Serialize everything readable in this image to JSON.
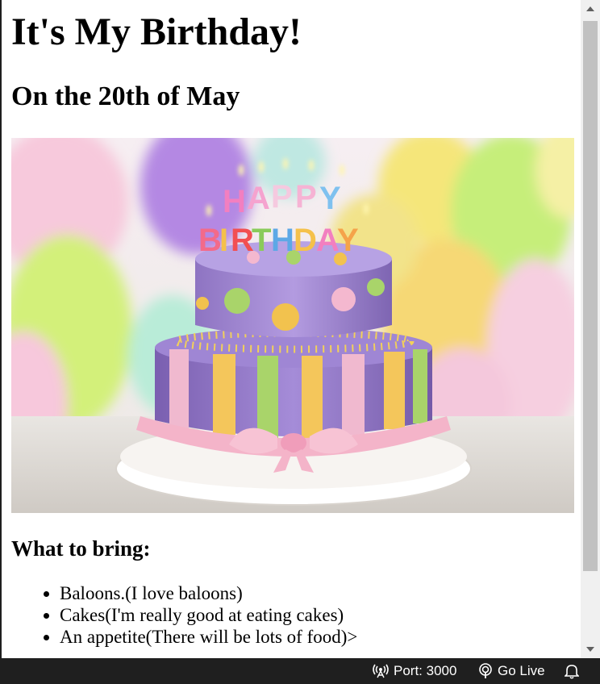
{
  "page": {
    "title": "It's My Birthday!",
    "subtitle": "On the 20th of May",
    "section_heading": "What to bring:",
    "bring_items": [
      "Baloons.(I love baloons)",
      "Cakes(I'm really good at eating cakes)",
      "An appetite(There will be lots of food)>"
    ],
    "cake_candle_text": {
      "line1": "HAPPY",
      "line2": "BIRTHDAY"
    }
  },
  "statusbar": {
    "port_label": "Port: 3000",
    "golive_label": "Go Live"
  },
  "icons": {
    "port": "broadcast-icon",
    "golive": "radio-tower-icon",
    "bell": "bell-icon"
  },
  "colors": {
    "statusbar_bg": "#1f1f1f",
    "scrollbar_thumb": "#c1c1c1"
  }
}
